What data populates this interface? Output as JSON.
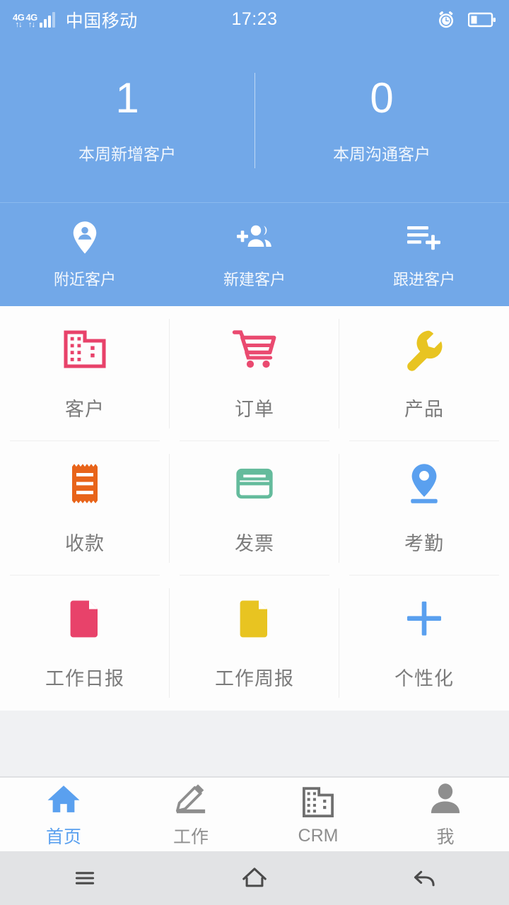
{
  "status_bar": {
    "network_label": "4G",
    "network_label_2": "4G",
    "carrier": "中国移动",
    "time": "17:23",
    "alarm_icon": "alarm-clock-icon",
    "battery_icon": "battery-icon"
  },
  "hero": {
    "stats": [
      {
        "value": "1",
        "label": "本周新增客户"
      },
      {
        "value": "0",
        "label": "本周沟通客户"
      }
    ]
  },
  "quick_actions": [
    {
      "label": "附近客户",
      "icon": "location-person-pin-icon"
    },
    {
      "label": "新建客户",
      "icon": "person-add-group-icon"
    },
    {
      "label": "跟进客户",
      "icon": "list-add-icon"
    }
  ],
  "grid": [
    {
      "label": "客户",
      "icon": "building-icon",
      "color": "#e8426a"
    },
    {
      "label": "订单",
      "icon": "shopping-cart-icon",
      "color": "#ea4a70"
    },
    {
      "label": "产品",
      "icon": "wrench-icon",
      "color": "#e8c421"
    },
    {
      "label": "收款",
      "icon": "receipt-icon",
      "color": "#e8641a"
    },
    {
      "label": "发票",
      "icon": "invoice-card-icon",
      "color": "#64bb9c"
    },
    {
      "label": "考勤",
      "icon": "attendance-pin-icon",
      "color": "#5aa0ef"
    },
    {
      "label": "工作日报",
      "icon": "document-pink-icon",
      "color": "#e8426a"
    },
    {
      "label": "工作周报",
      "icon": "document-yellow-icon",
      "color": "#e8c421"
    },
    {
      "label": "个性化",
      "icon": "plus-icon",
      "color": "#5aa0ef"
    }
  ],
  "tabbar": {
    "active_color": "#5aa0ef",
    "inactive_color": "#8e8e8e",
    "items": [
      {
        "label": "首页",
        "icon": "home-icon",
        "active": true
      },
      {
        "label": "工作",
        "icon": "pencil-icon",
        "active": false
      },
      {
        "label": "CRM",
        "icon": "building-icon",
        "active": false
      },
      {
        "label": "我",
        "icon": "person-icon",
        "active": false
      }
    ]
  },
  "navbar": {
    "items": [
      {
        "name": "menu",
        "icon": "menu-icon"
      },
      {
        "name": "home",
        "icon": "home-outline-icon"
      },
      {
        "name": "back",
        "icon": "back-arrow-icon"
      }
    ]
  },
  "theme": {
    "brand_blue": "#72a8e8",
    "accent_blue": "#5aa0ef"
  }
}
